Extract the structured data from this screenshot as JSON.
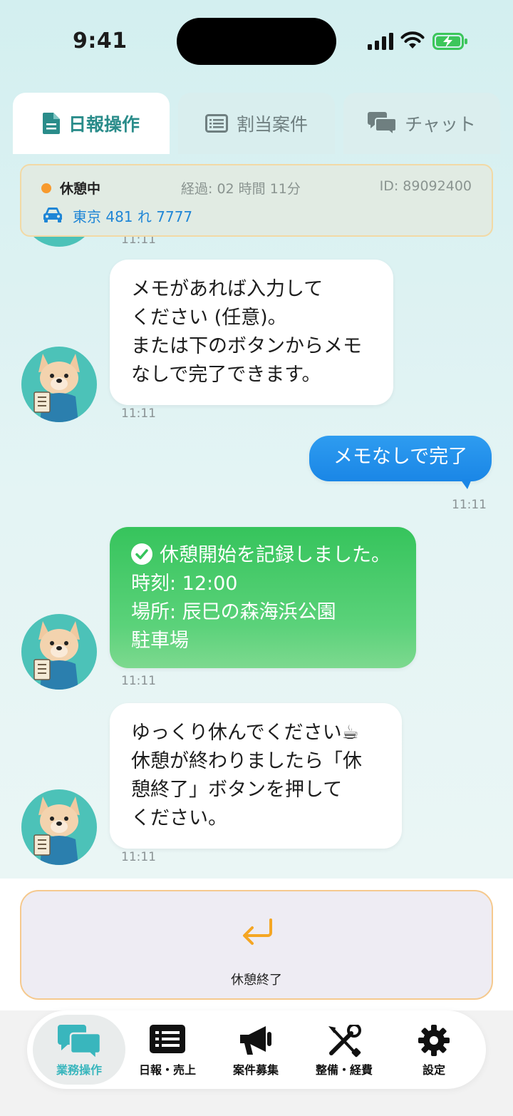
{
  "status_bar": {
    "time": "9:41"
  },
  "tabs": [
    {
      "label": "日報操作",
      "icon": "document-icon"
    },
    {
      "label": "割当案件",
      "icon": "list-icon"
    },
    {
      "label": "チャット",
      "icon": "chat-icon"
    }
  ],
  "info": {
    "status": "休憩中",
    "elapsed": "経過: 02 時間 11分",
    "id": "ID: 89092400",
    "plate": "東京 481 れ 7777",
    "status_color": "#f79a2e"
  },
  "messages": {
    "m0": {
      "time": "11:11"
    },
    "m1": {
      "lines": [
        "メモがあれば入力して",
        "ください (任意)。",
        "または下のボタンからメモ",
        "なしで完了できます。"
      ],
      "time": "11:11"
    },
    "m2": {
      "text": "メモなしで完了",
      "time": "11:11"
    },
    "m3": {
      "lines": [
        "休憩開始を記録しました。",
        "時刻: 12:00",
        "場所: 辰巳の森海浜公園",
        "駐車場"
      ],
      "time": "11:11"
    },
    "m4": {
      "lines": [
        "ゆっくり休んでください☕",
        "休憩が終わりましたら「休",
        "憩終了」ボタンを押して",
        "ください。"
      ],
      "time": "11:11"
    }
  },
  "action": {
    "label": "休憩終了",
    "icon": "return-arrow-icon"
  },
  "nav": [
    {
      "label": "業務操作",
      "icon": "chat-bubbles-icon",
      "active": true
    },
    {
      "label": "日報・売上",
      "icon": "list-icon"
    },
    {
      "label": "案件募集",
      "icon": "megaphone-icon"
    },
    {
      "label": "整備・経費",
      "icon": "tools-icon"
    },
    {
      "label": "設定",
      "icon": "gear-icon"
    }
  ],
  "colors": {
    "accent": "#2a8c8a",
    "user_bubble": "#1a86e6",
    "success": "#36c45c",
    "link": "#1f86d6"
  }
}
